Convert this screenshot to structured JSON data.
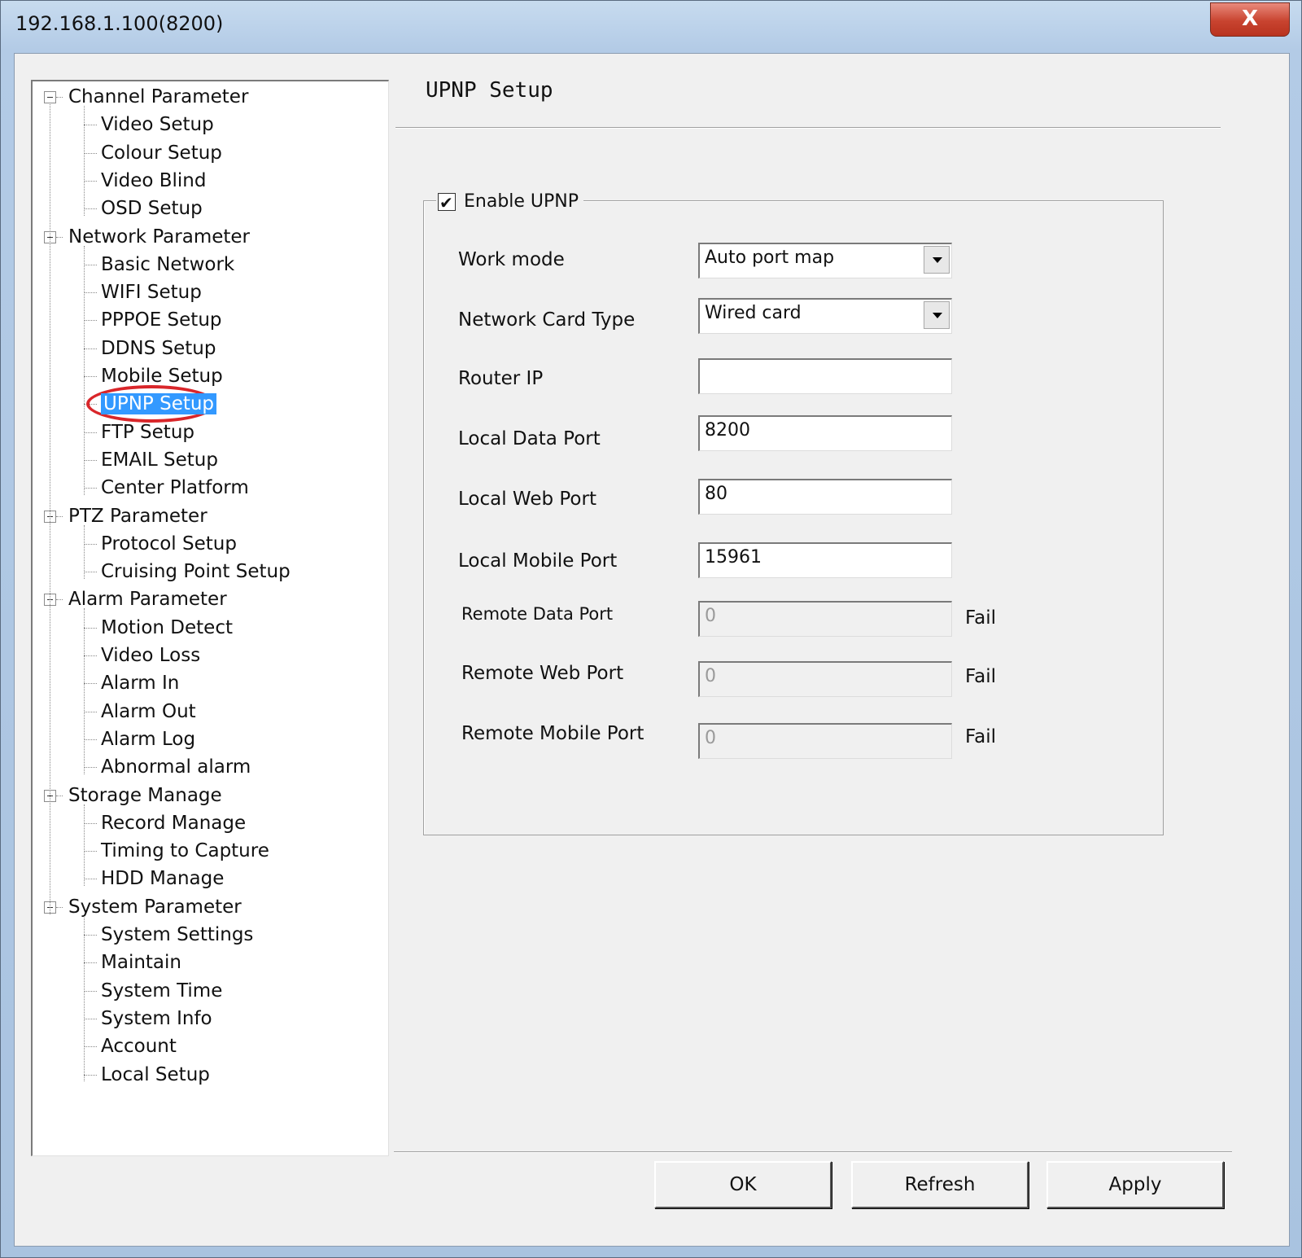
{
  "window": {
    "title": "192.168.1.100(8200)",
    "close_label": "X"
  },
  "tree": {
    "groups": [
      {
        "label": "Channel Parameter",
        "items": [
          "Video Setup",
          "Colour Setup",
          "Video Blind",
          "OSD Setup"
        ]
      },
      {
        "label": "Network Parameter",
        "items": [
          "Basic Network",
          "WIFI Setup",
          "PPPOE Setup",
          "DDNS Setup",
          "Mobile Setup",
          "UPNP Setup",
          "FTP Setup",
          "EMAIL Setup",
          "Center Platform"
        ]
      },
      {
        "label": "PTZ Parameter",
        "items": [
          "Protocol Setup",
          "Cruising Point Setup"
        ]
      },
      {
        "label": "Alarm Parameter",
        "items": [
          "Motion Detect",
          "Video Loss",
          "Alarm In",
          "Alarm Out",
          "Alarm Log",
          "Abnormal alarm"
        ]
      },
      {
        "label": "Storage Manage",
        "items": [
          "Record Manage",
          "Timing to Capture",
          "HDD Manage"
        ]
      },
      {
        "label": "System Parameter",
        "items": [
          "System Settings",
          "Maintain",
          "System Time",
          "System Info",
          "Account",
          "Local Setup"
        ]
      }
    ],
    "selected": "UPNP Setup"
  },
  "panel": {
    "heading": "UPNP Setup",
    "enable_label": "Enable UPNP",
    "enable_checked": true,
    "work_mode": {
      "label": "Work mode",
      "value": "Auto port map"
    },
    "network_card_type": {
      "label": "Network Card Type",
      "value": "Wired card"
    },
    "router_ip": {
      "label": "Router IP",
      "value": ""
    },
    "local_data_port": {
      "label": "Local Data Port",
      "value": "8200"
    },
    "local_web_port": {
      "label": "Local Web Port",
      "value": "80"
    },
    "local_mobile_port": {
      "label": "Local Mobile Port",
      "value": "15961"
    },
    "remote_data_port": {
      "label": "Remote Data Port",
      "value": "0",
      "status": "Fail"
    },
    "remote_web_port": {
      "label": "Remote Web Port",
      "value": "0",
      "status": "Fail"
    },
    "remote_mobile_port": {
      "label": "Remote Mobile Port",
      "value": "0",
      "status": "Fail"
    }
  },
  "buttons": {
    "ok": "OK",
    "refresh": "Refresh",
    "apply": "Apply"
  },
  "colors": {
    "selection": "#3399ff",
    "highlight_ring": "#d9262a",
    "close_button": "#c8432f"
  }
}
